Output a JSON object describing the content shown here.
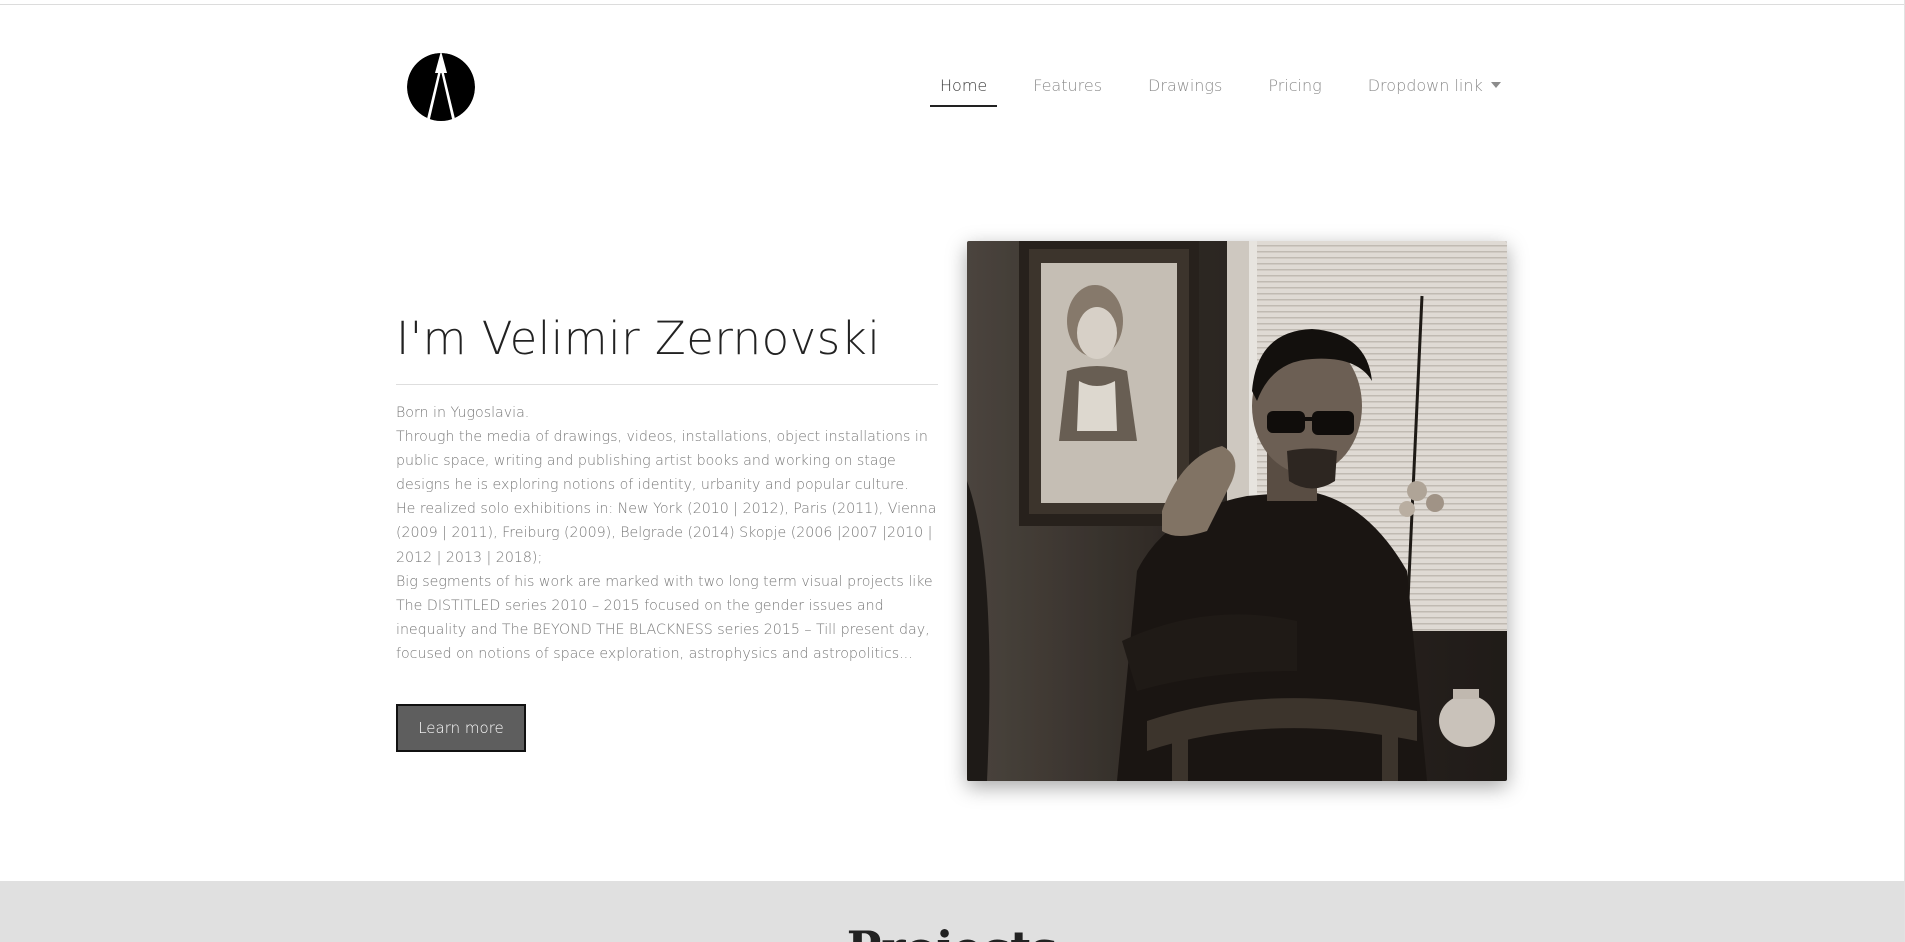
{
  "header": {
    "logo_icon": "a-triangle-logo-icon",
    "nav": [
      {
        "label": "Home",
        "active": true
      },
      {
        "label": "Features",
        "active": false
      },
      {
        "label": "Drawings",
        "active": false
      },
      {
        "label": "Pricing",
        "active": false
      },
      {
        "label": "Dropdown link",
        "active": false,
        "icon": "caret-down-icon"
      }
    ]
  },
  "hero": {
    "title": "I'm Velimir Zernovski",
    "bio": [
      "Born in Yugoslavia.",
      "Through the media of drawings, videos, installations, object installations in public space, writing and publishing artist books and working on stage designs he is exploring notions of identity, urbanity and popular culture.",
      "He realized solo exhibitions in: New York (2010 | 2012), Paris (2011), Vienna (2009 | 2011), Freiburg (2009), Belgrade (2014) Skopje (2006 |2007 |2010 | 2012 | 2013 | 2018);",
      "Big segments of his work are marked with two long term visual projects like The DISTITLED series 2010 – 2015 focused on the gender issues and inequality and The BEYOND THE BLACKNESS series 2015 – Till present day, focused on notions of space exploration, astrophysics and astropolitics..."
    ],
    "button_label": "Learn more"
  },
  "projects": {
    "title": "Projects"
  },
  "colors": {
    "text_dark": "#222222",
    "text_muted": "#7a7a7a",
    "button_bg": "#5e5e5e",
    "band_bg": "#e0e0e0"
  }
}
